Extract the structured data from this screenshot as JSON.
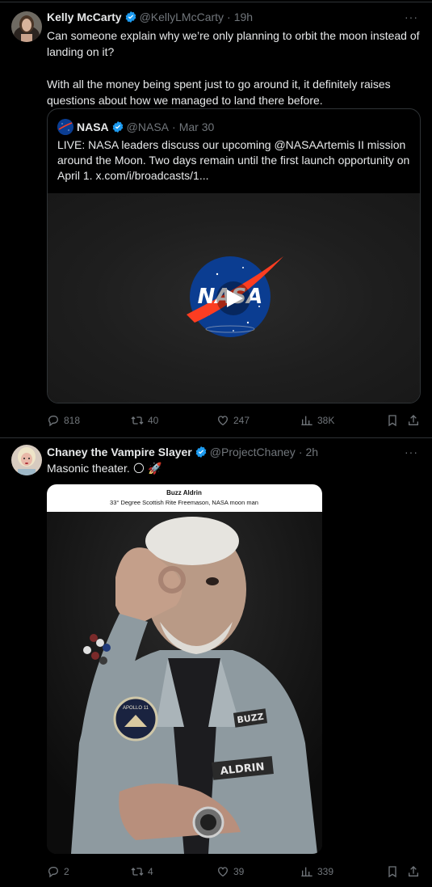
{
  "colors": {
    "background": "#000000",
    "text": "#e7e9ea",
    "muted": "#71767b",
    "verified": "#1d9bf0",
    "divider": "#2f3336"
  },
  "tweets": [
    {
      "name": "Kelly McCarty",
      "handle": "@KellyLMcCarty",
      "time": "19h",
      "text_line1": "Can someone explain why we’re only planning to orbit the moon instead of landing on it?",
      "text_line2": "With all the money being spent just to go around it, it definitely raises questions about how we managed to land there before.",
      "quote": {
        "name": "NASA",
        "handle": "@NASA",
        "time": "Mar 30",
        "text": "LIVE: NASA leaders discuss our upcoming @NASAArtemis II mission around the Moon. Two days remain until the first launch opportunity on April 1. x.com/i/broadcasts/1...",
        "video_logo_text": "NASA"
      },
      "actions": {
        "replies": "818",
        "reposts": "40",
        "likes": "247",
        "views": "38K"
      }
    },
    {
      "name": "Chaney the Vampire Slayer",
      "handle": "@ProjectChaney",
      "time": "2h",
      "text": "Masonic theater. 🌕 🚀",
      "photo": {
        "caption_title": "Buzz Aldrin",
        "caption_subtitle": "33° Degree Scottish Rite Freemason, NASA moon man",
        "patch_text": "APOLLO 11",
        "jacket_name_1": "BUZZ",
        "jacket_name_2": "ALDRIN"
      },
      "actions": {
        "replies": "2",
        "reposts": "4",
        "likes": "39",
        "views": "339"
      }
    }
  ],
  "more_label": "···",
  "icons": [
    "reply-icon",
    "repost-icon",
    "like-icon",
    "views-icon",
    "bookmark-icon",
    "share-icon",
    "verified-badge-icon",
    "play-icon"
  ]
}
